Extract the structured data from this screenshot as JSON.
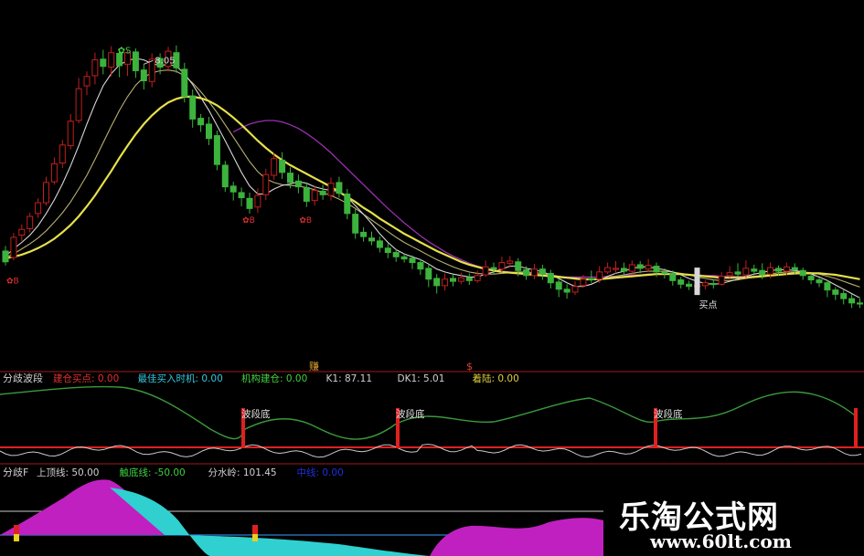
{
  "colors": {
    "up": "#c0201e",
    "down": "#3cb33c",
    "ma_yellow": "#e6e04a",
    "ma_purple": "#9a2fb0",
    "ma_white": "#d8d8d8",
    "ma_khaki": "#b8b070",
    "bg": "#000000",
    "red_line": "#e02020",
    "magenta": "#c020c0",
    "cyan": "#30d0d0"
  },
  "main_panel": {
    "high_label": "8.05",
    "sell_mark_top": "S",
    "buy_marks": [
      "B",
      "B",
      "B"
    ],
    "buy_point_label": "买点"
  },
  "separator_labels": {
    "left": "赚",
    "right": "$"
  },
  "indicator1": {
    "title": "分歧波段",
    "fields": [
      {
        "label": "建仓买点:",
        "value": "0.00",
        "color": "#e03030"
      },
      {
        "label": "最佳买入时机:",
        "value": "0.00",
        "color": "#30c8e0"
      },
      {
        "label": "机构建仓:",
        "value": "0.00",
        "color": "#40d040"
      },
      {
        "label": "K1:",
        "value": "87.11",
        "color": "#d0d0d0"
      },
      {
        "label": "DK1:",
        "value": "5.01",
        "color": "#d0d0d0"
      },
      {
        "label": "着陆:",
        "value": "0.00",
        "color": "#e0d040"
      }
    ],
    "bottom_labels": [
      "波段底",
      "波段底",
      "波段底"
    ]
  },
  "indicator2": {
    "title": "分歧F",
    "fields": [
      {
        "label": "上顶线:",
        "value": "50.00",
        "color": "#d0d0d0"
      },
      {
        "label": "触底线:",
        "value": "-50.00",
        "color": "#40d040"
      },
      {
        "label": "分水岭:",
        "value": "101.45",
        "color": "#d0d0d0"
      },
      {
        "label": "中线:",
        "value": "0.00",
        "color": "#2030e0"
      }
    ]
  },
  "watermark": {
    "brand": "乐淘公式网",
    "url": "www.60lt.com"
  },
  "chart_data": {
    "type": "candlestick",
    "candles": [
      [
        13.5,
        12.0,
        14.2,
        11.5
      ],
      [
        12.6,
        15.4,
        16.0,
        12.2
      ],
      [
        15.7,
        16.5,
        17.2,
        14.9
      ],
      [
        16.6,
        18.3,
        18.8,
        16.1
      ],
      [
        18.7,
        20.2,
        20.8,
        18.1
      ],
      [
        20.2,
        23.0,
        23.8,
        19.8
      ],
      [
        23.1,
        25.6,
        26.5,
        22.7
      ],
      [
        25.7,
        28.2,
        28.9,
        25.0
      ],
      [
        28.1,
        31.5,
        32.5,
        27.6
      ],
      [
        31.6,
        36.0,
        37.5,
        31.2
      ],
      [
        36.4,
        37.7,
        38.4,
        35.1
      ],
      [
        37.8,
        40.0,
        41.0,
        36.6
      ],
      [
        40.1,
        39.1,
        41.4,
        38.0
      ],
      [
        39.0,
        41.0,
        41.9,
        37.7
      ],
      [
        40.9,
        39.2,
        41.6,
        37.6
      ],
      [
        39.4,
        41.0,
        41.4,
        37.8
      ],
      [
        41.1,
        38.5,
        41.6,
        37.5
      ],
      [
        38.6,
        37.1,
        39.4,
        35.9
      ],
      [
        37.0,
        40.1,
        40.9,
        36.2
      ],
      [
        40.2,
        39.0,
        40.9,
        38.0
      ],
      [
        39.1,
        41.2,
        41.8,
        38.4
      ],
      [
        41.0,
        38.9,
        42.0,
        38.2
      ],
      [
        38.7,
        34.9,
        39.6,
        34.1
      ],
      [
        35.0,
        31.8,
        35.9,
        30.6
      ],
      [
        31.9,
        31.0,
        32.5,
        30.0
      ],
      [
        31.1,
        29.1,
        32.1,
        28.2
      ],
      [
        29.5,
        25.5,
        30.2,
        24.7
      ],
      [
        25.4,
        22.4,
        26.0,
        21.7
      ],
      [
        22.5,
        21.7,
        23.1,
        20.5
      ],
      [
        21.6,
        20.9,
        22.3,
        19.7
      ],
      [
        20.8,
        19.4,
        21.6,
        18.7
      ],
      [
        19.6,
        21.2,
        22.2,
        18.8
      ],
      [
        21.3,
        24.1,
        24.9,
        20.6
      ],
      [
        24.0,
        26.3,
        27.1,
        23.4
      ],
      [
        26.1,
        24.4,
        27.2,
        23.5
      ],
      [
        24.3,
        23.0,
        25.1,
        22.2
      ],
      [
        23.2,
        22.4,
        24.1,
        21.5
      ],
      [
        22.3,
        20.4,
        23.0,
        19.6
      ],
      [
        20.5,
        21.9,
        22.6,
        19.8
      ],
      [
        21.8,
        21.3,
        22.7,
        20.6
      ],
      [
        21.2,
        22.9,
        23.7,
        20.5
      ],
      [
        23.0,
        21.5,
        23.8,
        20.9
      ],
      [
        21.4,
        18.7,
        22.1,
        17.9
      ],
      [
        18.6,
        16.0,
        19.3,
        15.2
      ],
      [
        16.1,
        15.5,
        16.8,
        14.8
      ],
      [
        15.3,
        14.9,
        16.2,
        14.3
      ],
      [
        14.9,
        14.0,
        15.5,
        13.3
      ],
      [
        13.9,
        13.3,
        14.6,
        12.5
      ],
      [
        13.3,
        12.7,
        13.8,
        12.0
      ],
      [
        12.7,
        12.4,
        13.2,
        11.9
      ],
      [
        12.5,
        11.9,
        12.9,
        11.0
      ],
      [
        11.9,
        11.0,
        12.4,
        10.2
      ],
      [
        11.1,
        9.6,
        11.7,
        8.5
      ],
      [
        9.7,
        8.7,
        10.3,
        7.6
      ],
      [
        8.7,
        9.6,
        10.4,
        8.0
      ],
      [
        9.7,
        9.3,
        10.3,
        8.6
      ],
      [
        9.3,
        9.8,
        10.5,
        8.9
      ],
      [
        9.8,
        9.4,
        10.4,
        8.8
      ],
      [
        9.4,
        10.1,
        10.8,
        9.1
      ],
      [
        10.2,
        11.3,
        12.2,
        9.9
      ],
      [
        11.2,
        11.0,
        11.9,
        10.3
      ],
      [
        11.0,
        11.9,
        12.7,
        10.5
      ],
      [
        11.8,
        12.1,
        12.8,
        11.2
      ],
      [
        12.0,
        10.8,
        12.5,
        10.0
      ],
      [
        10.9,
        10.1,
        11.4,
        9.5
      ],
      [
        10.1,
        11.0,
        11.7,
        9.6
      ],
      [
        11.0,
        10.3,
        11.6,
        9.5
      ],
      [
        10.4,
        9.1,
        10.9,
        8.3
      ],
      [
        9.2,
        8.2,
        9.7,
        7.1
      ],
      [
        8.2,
        7.8,
        8.9,
        6.9
      ],
      [
        7.8,
        8.6,
        9.3,
        7.4
      ],
      [
        8.7,
        9.6,
        10.2,
        8.4
      ],
      [
        9.7,
        9.6,
        10.8,
        9.1
      ],
      [
        9.6,
        10.6,
        11.4,
        9.1
      ],
      [
        10.6,
        11.2,
        11.9,
        10.3
      ],
      [
        11.1,
        11.1,
        12.1,
        10.4
      ],
      [
        11.1,
        10.7,
        11.9,
        10.1
      ],
      [
        10.7,
        11.6,
        12.2,
        10.2
      ],
      [
        11.6,
        11.1,
        12.1,
        10.4
      ],
      [
        11.0,
        11.5,
        12.4,
        10.6
      ],
      [
        11.4,
        10.6,
        11.9,
        9.9
      ],
      [
        10.6,
        10.4,
        11.1,
        9.7
      ],
      [
        10.4,
        9.4,
        10.8,
        8.7
      ],
      [
        9.5,
        8.9,
        9.9,
        8.3
      ],
      [
        8.9,
        8.6,
        9.4,
        8.1
      ],
      [
        8.6,
        8.7,
        9.1,
        8.0
      ],
      [
        8.7,
        9.1,
        9.4,
        8.2
      ],
      [
        9.0,
        8.9,
        9.5,
        8.3
      ],
      [
        8.9,
        10.0,
        10.6,
        8.7
      ],
      [
        10.1,
        10.5,
        11.4,
        9.8
      ],
      [
        10.6,
        10.3,
        11.8,
        9.9
      ],
      [
        10.2,
        11.1,
        12.2,
        9.8
      ],
      [
        11.0,
        10.7,
        11.6,
        10.1
      ],
      [
        10.8,
        10.2,
        11.8,
        9.6
      ],
      [
        10.3,
        11.2,
        11.9,
        9.7
      ],
      [
        11.1,
        10.7,
        11.5,
        10.1
      ],
      [
        10.7,
        11.3,
        11.9,
        10.2
      ],
      [
        11.2,
        10.9,
        11.8,
        10.3
      ],
      [
        10.8,
        10.1,
        11.2,
        9.5
      ],
      [
        10.0,
        9.5,
        10.4,
        8.9
      ],
      [
        9.5,
        9.1,
        9.8,
        8.5
      ],
      [
        9.1,
        8.1,
        9.5,
        7.1
      ],
      [
        8.1,
        7.5,
        8.5,
        6.7
      ],
      [
        7.6,
        6.9,
        8.1,
        6.1
      ],
      [
        6.9,
        6.3,
        7.5,
        5.6
      ],
      [
        6.3,
        6.2,
        6.9,
        5.6
      ]
    ],
    "ma": {
      "white": [
        12.8,
        13.8,
        14.7,
        15.7,
        17.0,
        18.7,
        20.6,
        22.8,
        25.3,
        28.1,
        31.1,
        33.9,
        36.4,
        38.1,
        39.3,
        39.9,
        40.2,
        40.0,
        39.5,
        39.2,
        39.4,
        39.1,
        38.1,
        36.6,
        34.8,
        33.0,
        30.9,
        28.8,
        26.6,
        24.4,
        22.5,
        21.4,
        21.4,
        22.1,
        22.6,
        22.8,
        23.1,
        22.9,
        22.4,
        22.1,
        21.9,
        21.8,
        21.0,
        19.8,
        18.6,
        17.3,
        15.9,
        14.7,
        13.7,
        13.1,
        12.7,
        12.3,
        11.7,
        11.0,
        10.6,
        10.3,
        10.1,
        9.9,
        9.9,
        10.3,
        10.6,
        11.0,
        11.4,
        11.4,
        11.1,
        10.9,
        10.6,
        10.2,
        9.7,
        9.1,
        8.6,
        8.6,
        8.9,
        9.4,
        10.0,
        10.4,
        10.7,
        11.1,
        11.3,
        11.3,
        11.1,
        10.9,
        10.6,
        10.2,
        9.7,
        9.3,
        9.0,
        8.9,
        9.0,
        9.3,
        9.6,
        10.0,
        10.3,
        10.5,
        10.8,
        10.9,
        10.9,
        10.8,
        10.6,
        10.3,
        9.9,
        9.4,
        8.8,
        8.2,
        7.6,
        7.0
      ],
      "khaki": [
        12.6,
        13.1,
        13.8,
        14.5,
        15.3,
        16.3,
        17.5,
        18.8,
        20.3,
        22.1,
        24.0,
        26.2,
        28.5,
        30.8,
        33.0,
        34.9,
        36.5,
        37.6,
        38.2,
        38.5,
        38.6,
        38.4,
        37.8,
        36.8,
        35.6,
        34.2,
        32.7,
        31.0,
        29.3,
        27.6,
        25.9,
        24.5,
        23.5,
        23.0,
        22.7,
        22.6,
        22.5,
        22.3,
        22.0,
        21.6,
        21.2,
        20.7,
        20.1,
        19.4,
        18.6,
        17.8,
        17.0,
        16.2,
        15.4,
        14.7,
        14.1,
        13.5,
        12.9,
        12.3,
        11.8,
        11.3,
        10.9,
        10.6,
        10.4,
        10.3,
        10.3,
        10.4,
        10.5,
        10.6,
        10.6,
        10.5,
        10.4,
        10.2,
        10.0,
        9.8,
        9.6,
        9.5,
        9.5,
        9.6,
        9.8,
        10.0,
        10.2,
        10.4,
        10.6,
        10.7,
        10.7,
        10.7,
        10.6,
        10.4,
        10.2,
        9.9,
        9.7,
        9.5,
        9.4,
        9.4,
        9.5,
        9.7,
        9.9,
        10.1,
        10.3,
        10.5,
        10.6,
        10.6,
        10.6,
        10.5,
        10.3,
        10.0,
        9.7,
        9.3,
        8.9,
        8.5
      ],
      "yellow": [
        12.5,
        12.7,
        13.0,
        13.4,
        13.9,
        14.5,
        15.2,
        16.1,
        17.1,
        18.3,
        19.7,
        21.2,
        22.9,
        24.6,
        26.4,
        28.1,
        29.7,
        31.1,
        32.3,
        33.3,
        34.1,
        34.6,
        34.9,
        34.9,
        34.7,
        34.3,
        33.7,
        32.9,
        32.0,
        31.0,
        29.9,
        28.8,
        27.8,
        26.9,
        26.1,
        25.4,
        24.8,
        24.2,
        23.6,
        23.0,
        22.4,
        21.7,
        21.0,
        20.3,
        19.5,
        18.8,
        18.0,
        17.3,
        16.6,
        15.9,
        15.3,
        14.7,
        14.1,
        13.5,
        13.0,
        12.5,
        12.0,
        11.6,
        11.3,
        11.0,
        10.8,
        10.6,
        10.5,
        10.4,
        10.3,
        10.2,
        10.1,
        10.0,
        9.9,
        9.8,
        9.7,
        9.6,
        9.6,
        9.6,
        9.7,
        9.8,
        9.9,
        10.0,
        10.1,
        10.2,
        10.3,
        10.3,
        10.3,
        10.3,
        10.2,
        10.1,
        10.0,
        9.9,
        9.8,
        9.8,
        9.8,
        9.8,
        9.9,
        10.0,
        10.1,
        10.2,
        10.3,
        10.4,
        10.4,
        10.4,
        10.4,
        10.3,
        10.2,
        10.0,
        9.8,
        9.6
      ],
      "purple": [
        null,
        null,
        null,
        null,
        null,
        null,
        null,
        null,
        null,
        null,
        null,
        null,
        null,
        null,
        null,
        null,
        null,
        null,
        null,
        null,
        null,
        null,
        null,
        null,
        null,
        null,
        null,
        null,
        30.0,
        30.6,
        31.1,
        31.4,
        31.6,
        31.6,
        31.4,
        31.0,
        30.5,
        29.8,
        29.0,
        28.1,
        27.1,
        26.0,
        24.9,
        23.8,
        22.7,
        21.6,
        20.5,
        19.4,
        18.4,
        17.4,
        16.5,
        15.6,
        14.8,
        14.1,
        13.4,
        12.8,
        12.3,
        11.8,
        11.4,
        11.1,
        10.9,
        10.7,
        10.6,
        10.5,
        10.4,
        10.3,
        10.2,
        10.1,
        10.0,
        9.9,
        9.9,
        9.9,
        9.9,
        9.9,
        10.0,
        10.0,
        10.1,
        10.2,
        10.2,
        10.3,
        10.3,
        10.3,
        10.3,
        10.3,
        10.2,
        10.2,
        10.1,
        10.1,
        10.0,
        10.0,
        10.0,
        10.0,
        10.0,
        10.1,
        10.1,
        10.2,
        10.3,
        10.3,
        10.4,
        10.4,
        10.4,
        10.3,
        10.2,
        10.0,
        9.8,
        9.6
      ]
    }
  }
}
